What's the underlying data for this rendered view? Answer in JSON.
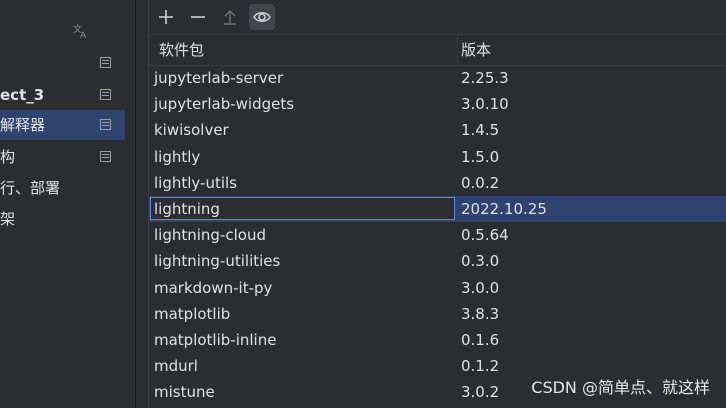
{
  "sidebar": {
    "items": [
      {
        "label": "ect_3",
        "bold": true,
        "selected": false,
        "has_icon": true
      },
      {
        "label": "解释器",
        "bold": false,
        "selected": true,
        "has_icon": true
      },
      {
        "label": "构",
        "bold": false,
        "selected": false,
        "has_icon": true
      },
      {
        "label": "行、部署",
        "bold": false,
        "selected": false,
        "has_icon": false
      },
      {
        "label": "架",
        "bold": false,
        "selected": false,
        "has_icon": false
      }
    ]
  },
  "toolbar": {
    "buttons": [
      "add-icon",
      "remove-icon",
      "upgrade-icon",
      "eye-icon"
    ]
  },
  "table": {
    "headers": {
      "package": "软件包",
      "version": "版本"
    },
    "rows": [
      {
        "package": "jupyterlab-server",
        "version": "2.25.3"
      },
      {
        "package": "jupyterlab-widgets",
        "version": "3.0.10"
      },
      {
        "package": "kiwisolver",
        "version": "1.4.5"
      },
      {
        "package": "lightly",
        "version": "1.5.0"
      },
      {
        "package": "lightly-utils",
        "version": "0.0.2"
      },
      {
        "package": "lightning",
        "version": "2022.10.25"
      },
      {
        "package": "lightning-cloud",
        "version": "0.5.64"
      },
      {
        "package": "lightning-utilities",
        "version": "0.3.0"
      },
      {
        "package": "markdown-it-py",
        "version": "3.0.0"
      },
      {
        "package": "matplotlib",
        "version": "3.8.3"
      },
      {
        "package": "matplotlib-inline",
        "version": "0.1.6"
      },
      {
        "package": "mdurl",
        "version": "0.1.2"
      },
      {
        "package": "mistune",
        "version": "3.0.2"
      }
    ],
    "selected_index": 5
  },
  "watermark": "CSDN @简单点、就这样",
  "colors": {
    "background": "#2b2d30",
    "selection": "#2e436e",
    "focus_border": "#548af7",
    "text": "#dfe1e5"
  }
}
